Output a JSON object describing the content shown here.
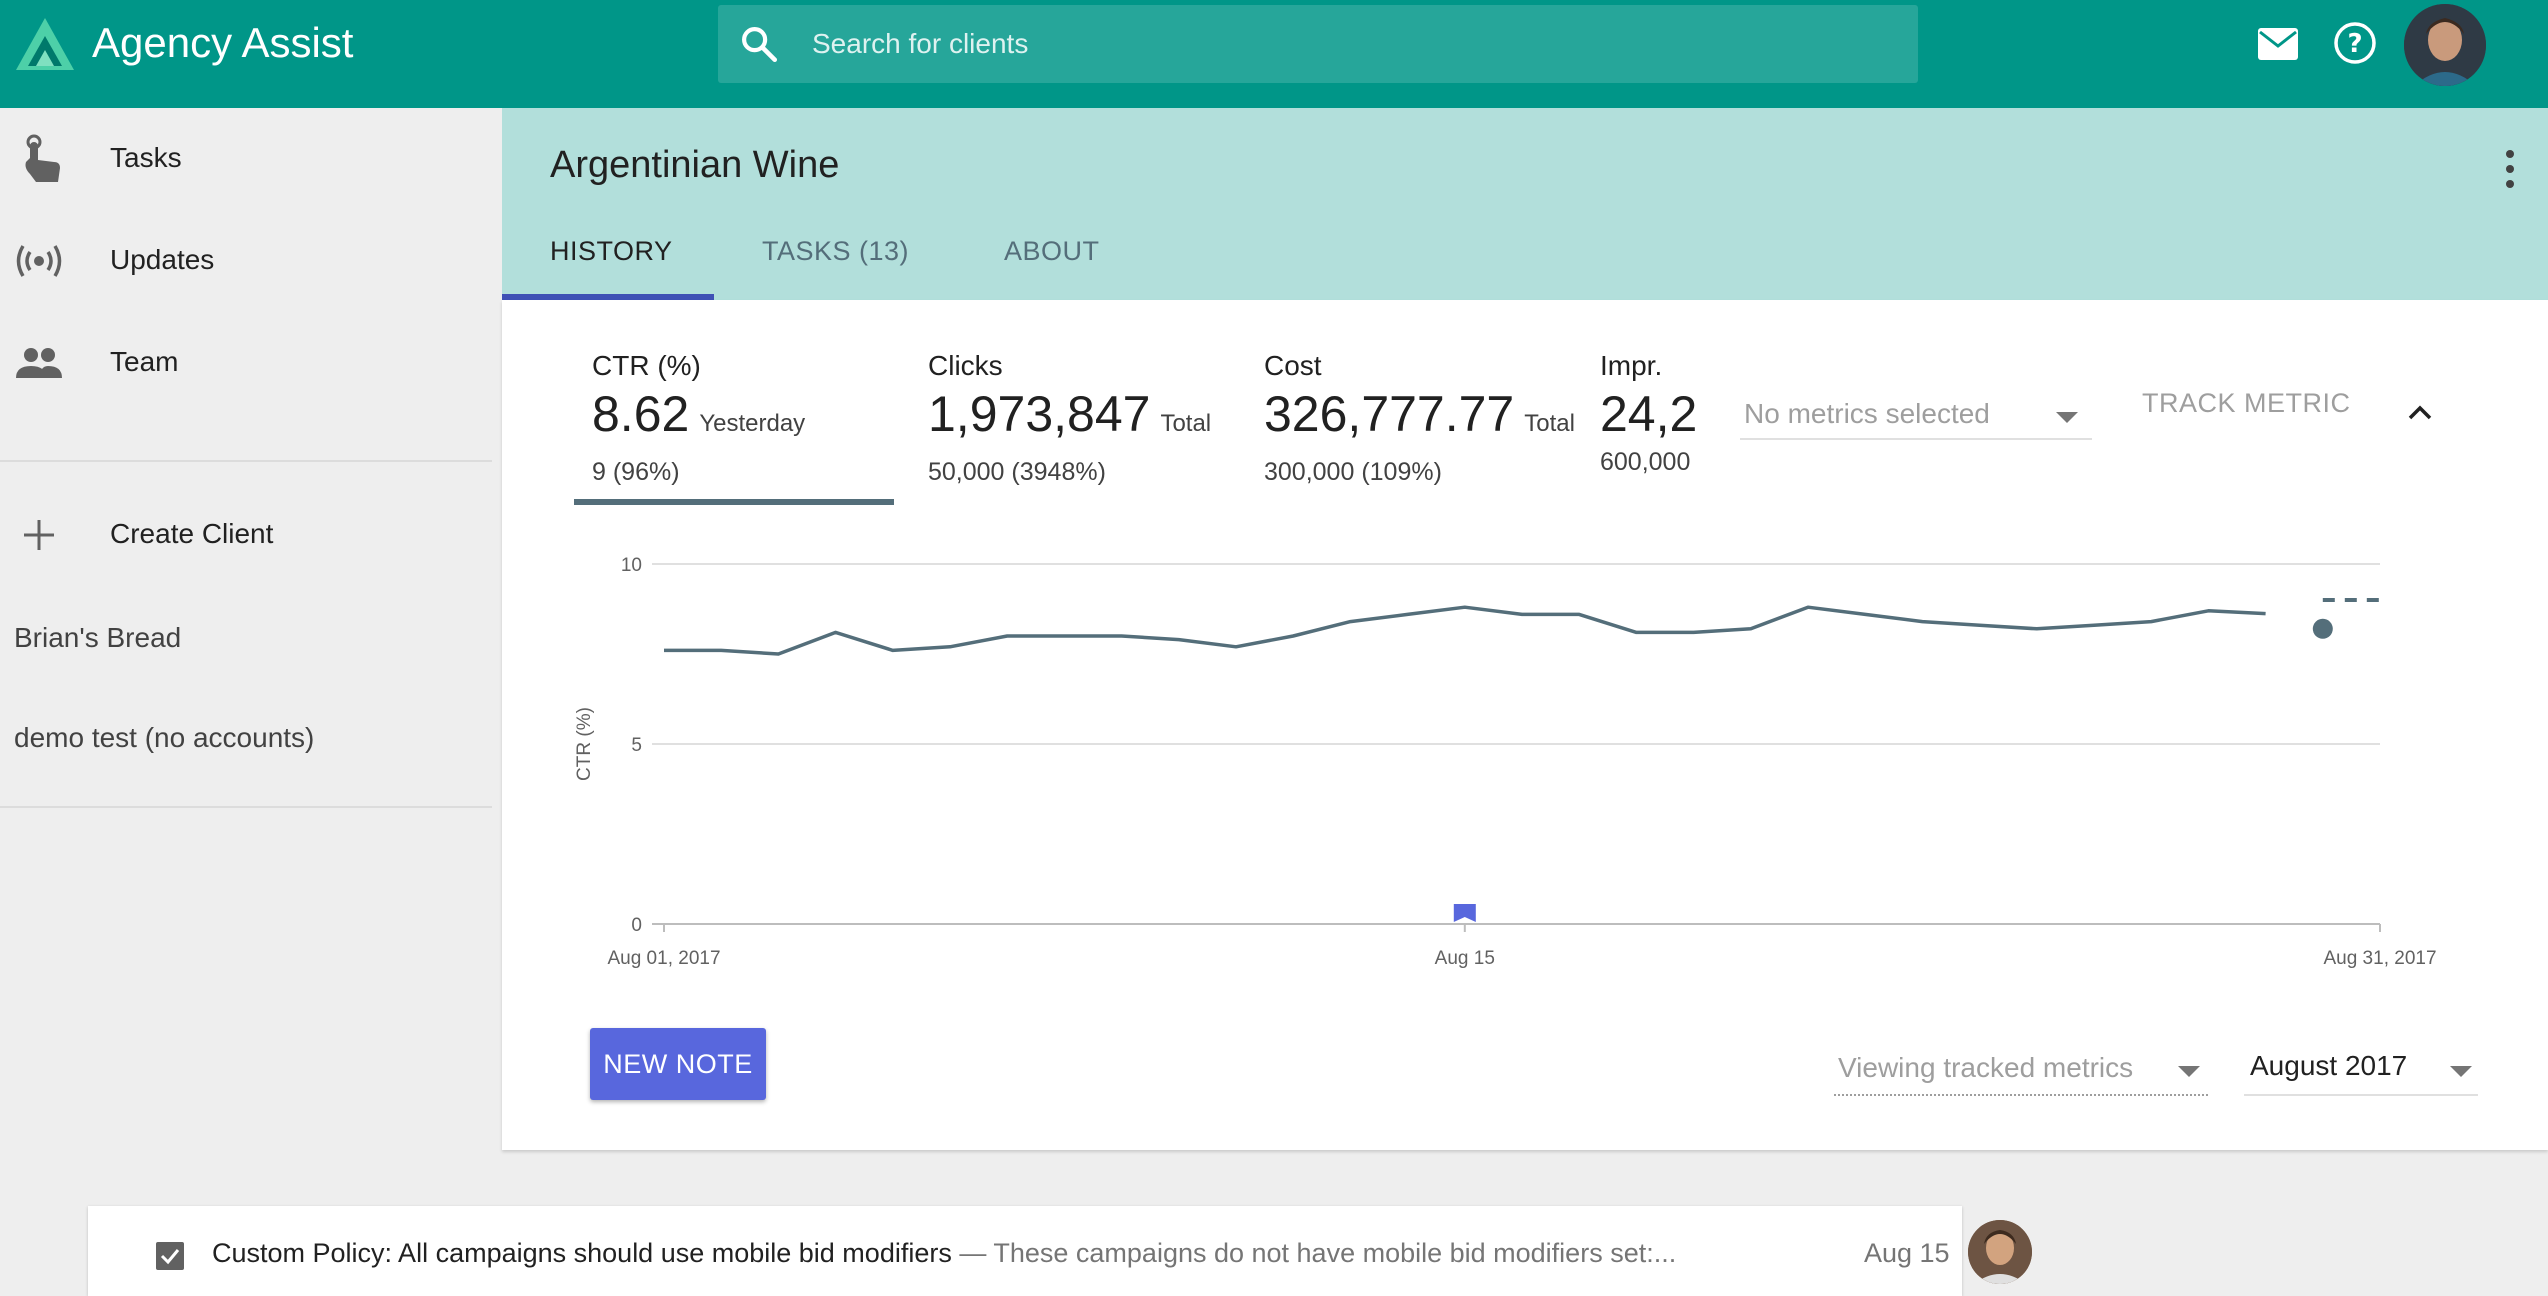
{
  "app": {
    "title": "Agency Assist"
  },
  "search": {
    "placeholder": "Search for clients"
  },
  "sidebar": {
    "nav": [
      {
        "label": "Tasks",
        "icon": "touch-icon"
      },
      {
        "label": "Updates",
        "icon": "broadcast-icon"
      },
      {
        "label": "Team",
        "icon": "people-icon"
      }
    ],
    "create_label": "Create Client",
    "clients": [
      "Brian's Bread",
      "demo test (no accounts)"
    ]
  },
  "client": {
    "name": "Argentinian Wine",
    "tabs": [
      "HISTORY",
      "TASKS (13)",
      "ABOUT"
    ],
    "active_tab": "HISTORY"
  },
  "metrics": [
    {
      "label": "CTR (%)",
      "value": "8.62",
      "suffix": "Yesterday",
      "sub": "9 (96%)"
    },
    {
      "label": "Clicks",
      "value": "1,973,847",
      "suffix": "Total",
      "sub": "50,000 (3948%)"
    },
    {
      "label": "Cost",
      "value": "326,777.77",
      "suffix": "Total",
      "sub": "300,000 (109%)"
    },
    {
      "label": "Impr.",
      "value": "24,2",
      "suffix": "",
      "sub": "600,000"
    }
  ],
  "metric_select": {
    "placeholder": "No metrics selected"
  },
  "track_metric_label": "TRACK METRIC",
  "chart_data": {
    "type": "line",
    "ylabel": "CTR (%)",
    "ylim": [
      0,
      10
    ],
    "yticks": [
      "0",
      "5",
      "10"
    ],
    "xticks": [
      "Aug 01, 2017",
      "Aug 15",
      "Aug 31, 2017"
    ],
    "x_range": [
      "2017-08-01",
      "2017-08-31"
    ],
    "series": [
      {
        "x": [
          "2017-08-01",
          "2017-08-02",
          "2017-08-03",
          "2017-08-04",
          "2017-08-05",
          "2017-08-06",
          "2017-08-07",
          "2017-08-08",
          "2017-08-09",
          "2017-08-10",
          "2017-08-11",
          "2017-08-12",
          "2017-08-13",
          "2017-08-14",
          "2017-08-15",
          "2017-08-16",
          "2017-08-17",
          "2017-08-18",
          "2017-08-19",
          "2017-08-20",
          "2017-08-21",
          "2017-08-22",
          "2017-08-23",
          "2017-08-24",
          "2017-08-25",
          "2017-08-26",
          "2017-08-27",
          "2017-08-28",
          "2017-08-29"
        ],
        "values": [
          7.6,
          7.6,
          7.5,
          8.1,
          7.6,
          7.7,
          8.0,
          8.0,
          8.0,
          7.9,
          7.7,
          8.0,
          8.4,
          8.6,
          8.8,
          8.6,
          8.6,
          8.1,
          8.1,
          8.2,
          8.8,
          8.6,
          8.4,
          8.3,
          8.2,
          8.3,
          8.4,
          8.7,
          8.62
        ],
        "color": "#546e7a"
      }
    ],
    "current_point": {
      "x": "2017-08-30",
      "value": 8.2
    },
    "target_line": {
      "value": 9,
      "x_from": "2017-08-30",
      "x_to": "2017-08-31",
      "style": "dashed"
    },
    "note_marker": {
      "x": "2017-08-15"
    },
    "grid": true
  },
  "actions": {
    "new_note": "NEW NOTE"
  },
  "view_select": {
    "value": "Viewing tracked metrics"
  },
  "month_select": {
    "value": "August 2017"
  },
  "task": {
    "title": "Custom Policy: All campaigns should use mobile bid modifiers",
    "separator": " — ",
    "description": "These campaigns do not have mobile bid modifiers set:...",
    "date": "Aug 15",
    "checked": true
  },
  "colors": {
    "topbar": "#009688",
    "search_bg": "#26a69a",
    "header_bg": "#b2dfdb",
    "primary_button": "#5867dd",
    "tab_indicator": "#3f51b5",
    "line": "#546e7a"
  }
}
